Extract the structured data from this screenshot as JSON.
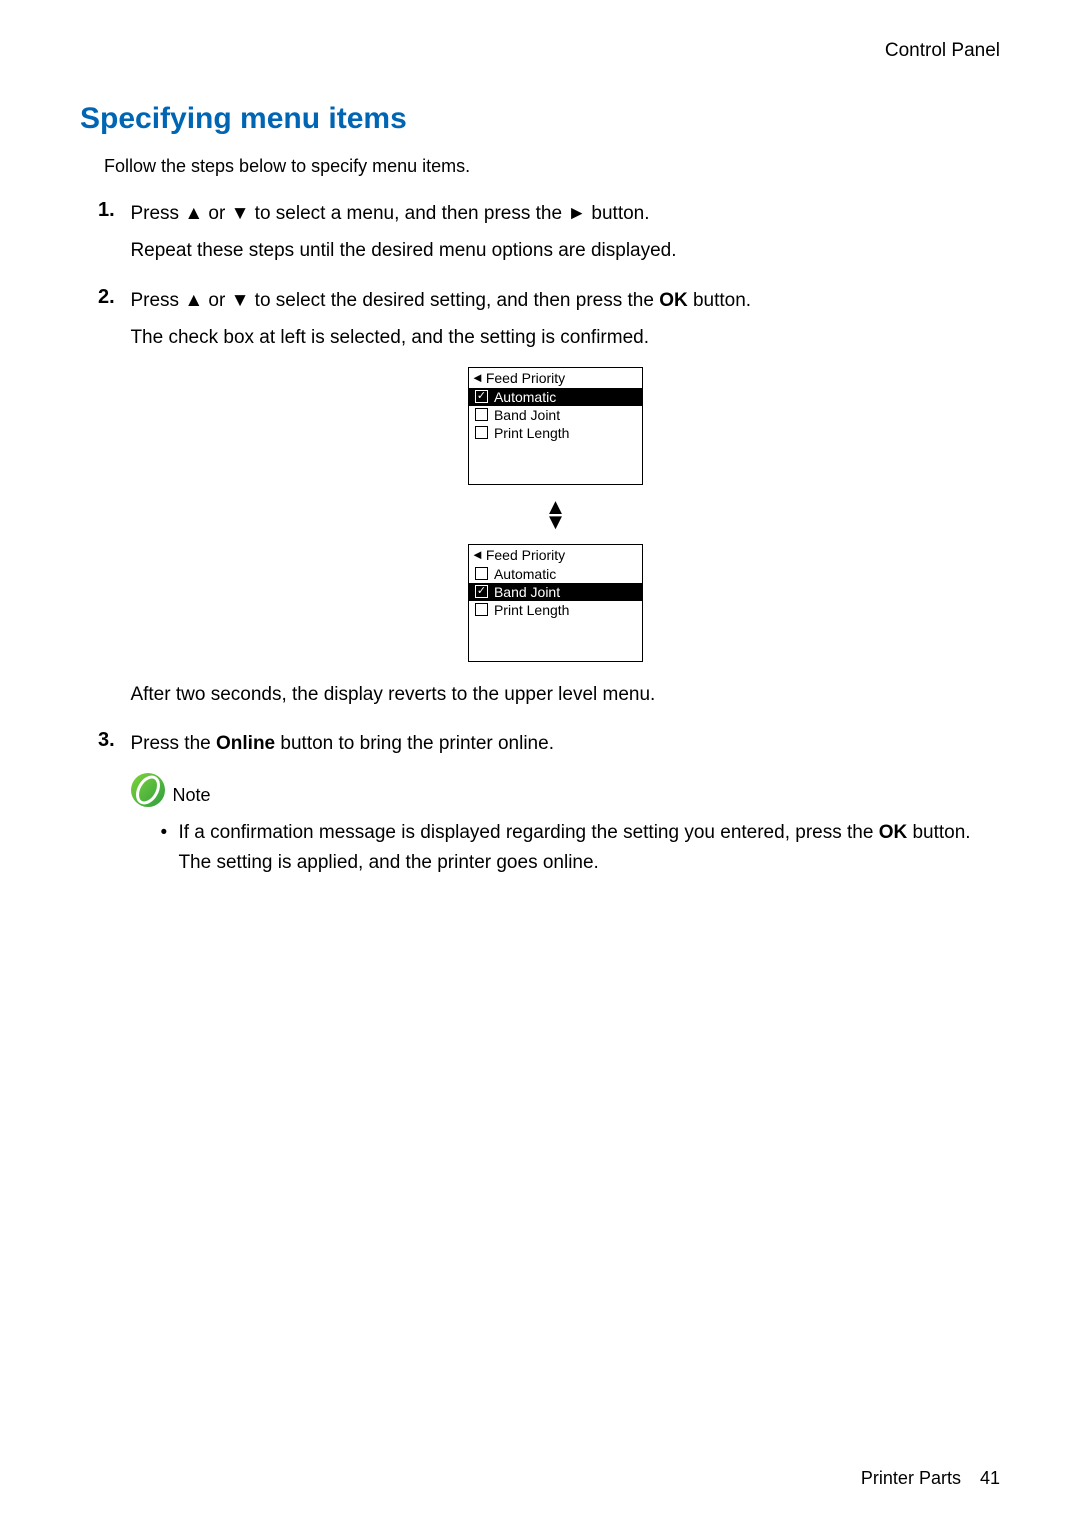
{
  "header": {
    "right": "Control Panel"
  },
  "section_title": "Specifying menu items",
  "intro": "Follow the steps below to specify menu items.",
  "steps": [
    {
      "num": "1.",
      "line1_pre": "Press ",
      "line1_sym1": "▲",
      "line1_mid1": " or ",
      "line1_sym2": "▼",
      "line1_mid2": " to select a menu, and then press the ",
      "line1_sym3": "►",
      "line1_post": " button.",
      "line2": "Repeat these steps until the desired menu options are displayed."
    },
    {
      "num": "2.",
      "line1_pre": "Press ",
      "line1_sym1": "▲",
      "line1_mid1": " or ",
      "line1_sym2": "▼",
      "line1_mid2": " to select the desired setting, and then press the ",
      "line1_bold": "OK",
      "line1_post": " button.",
      "line2": "The check box at left is selected, and the setting is confirmed."
    },
    {
      "num": "3.",
      "line1_pre": "Press the ",
      "line1_bold": "Online",
      "line1_post": " button to bring the printer online."
    }
  ],
  "lcd": {
    "title_arrow": "◄",
    "title": "Feed Priority",
    "before": {
      "rows": [
        {
          "label": "Automatic",
          "selected": true,
          "checked": true
        },
        {
          "label": "Band Joint",
          "selected": false,
          "checked": false
        },
        {
          "label": "Print Length",
          "selected": false,
          "checked": false
        }
      ]
    },
    "between": {
      "up": "▲",
      "down": "▼"
    },
    "after": {
      "rows": [
        {
          "label": "Automatic",
          "selected": false,
          "checked": false
        },
        {
          "label": "Band Joint",
          "selected": true,
          "checked": true
        },
        {
          "label": "Print Length",
          "selected": false,
          "checked": false
        }
      ]
    }
  },
  "after_lcd": "After two seconds, the display reverts to the upper level menu.",
  "note": {
    "label": "Note",
    "items": [
      {
        "pre": "If a confirmation message is displayed regarding the setting you entered, press the ",
        "bold": "OK",
        "post": " button. The setting is applied, and the printer goes online."
      }
    ]
  },
  "footer": {
    "section": "Printer Parts",
    "page": "41"
  }
}
